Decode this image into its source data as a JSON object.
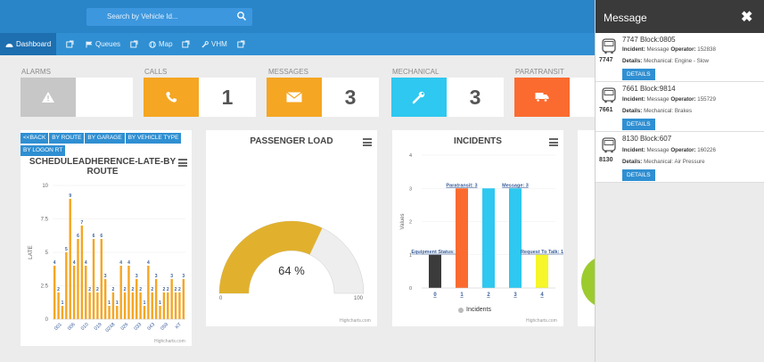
{
  "search": {
    "placeholder": "Search by Vehicle Id..."
  },
  "nav": [
    {
      "label": "Dashboard"
    },
    {
      "label": "Queues"
    },
    {
      "label": "Map"
    },
    {
      "label": "VHM"
    }
  ],
  "tiles": [
    {
      "label": "ALARMS",
      "value": "",
      "color": "#c7c7c7",
      "icon": "warning-icon"
    },
    {
      "label": "CALLS",
      "value": "1",
      "color": "#f5a623",
      "icon": "phone-icon"
    },
    {
      "label": "MESSAGES",
      "value": "3",
      "color": "#f5a623",
      "icon": "envelope-icon"
    },
    {
      "label": "MECHANICAL",
      "value": "3",
      "color": "#2ec8f0",
      "icon": "wrench-icon"
    },
    {
      "label": "PARATRANSIT",
      "value": "",
      "color": "#fb6b2f",
      "icon": "truck-icon"
    }
  ],
  "drill_buttons": [
    "<<BACK",
    "BY ROUTE",
    "BY GARAGE",
    "BY VEHICLE TYPE",
    "BY LOGON RT"
  ],
  "credit": "Highcharts.com",
  "chart_data": [
    {
      "type": "bar",
      "title": "SCHEDULEADHERENCE-LATE-BY ROUTE",
      "ylabel": "LATE",
      "ylim": [
        0,
        10
      ],
      "yticks": [
        "0",
        "2.5",
        "5",
        "7.5",
        "10"
      ],
      "xticks": [
        "001",
        "006",
        "010",
        "019",
        "0248",
        "026",
        "033",
        "043",
        "059",
        "KT"
      ],
      "values": [
        4,
        2,
        1,
        5,
        9,
        4,
        6,
        7,
        4,
        2,
        6,
        2,
        6,
        3,
        1,
        2,
        1,
        4,
        2,
        4,
        2,
        3,
        2,
        1,
        4,
        2,
        3,
        1,
        2,
        2,
        3,
        2,
        2,
        3
      ]
    },
    {
      "type": "gauge",
      "title": "PASSENGER LOAD",
      "value": 64,
      "value_label": "64 %",
      "min": "0",
      "max": "100"
    },
    {
      "type": "bar",
      "title": "INCIDENTS",
      "ylabel": "Values",
      "ylim": [
        0,
        4
      ],
      "yticks": [
        "0",
        "1",
        "2",
        "3",
        "4"
      ],
      "categories": [
        "0",
        "1",
        "2",
        "3",
        "4"
      ],
      "values": [
        1,
        3,
        3,
        3,
        1
      ],
      "colors": [
        "#3b3b3b",
        "#fb6b2f",
        "#2ec8f0",
        "#2ec8f0",
        "#f6f62a"
      ],
      "data_labels": [
        "Equipment Status: 1",
        "Paratransit: 3",
        "",
        "Message: 3",
        "Request To Talk: 1"
      ],
      "legend": "Incidents"
    }
  ],
  "message_panel": {
    "title": "Message",
    "messages": [
      {
        "bus_number": "7747",
        "header": "7747 Block:0805",
        "incident": "Message",
        "operator": "152838",
        "details": "Mechanical: Engine - Slow",
        "button": "DETAILS"
      },
      {
        "bus_number": "7661",
        "header": "7661 Block:9814",
        "incident": "Message",
        "operator": "155729",
        "details": "Mechanical: Brakes",
        "button": "DETAILS"
      },
      {
        "bus_number": "8130",
        "header": "8130 Block:607",
        "incident": "Message",
        "operator": "160226",
        "details": "Mechanical: Air Pressure",
        "button": "DETAILS"
      }
    ]
  }
}
